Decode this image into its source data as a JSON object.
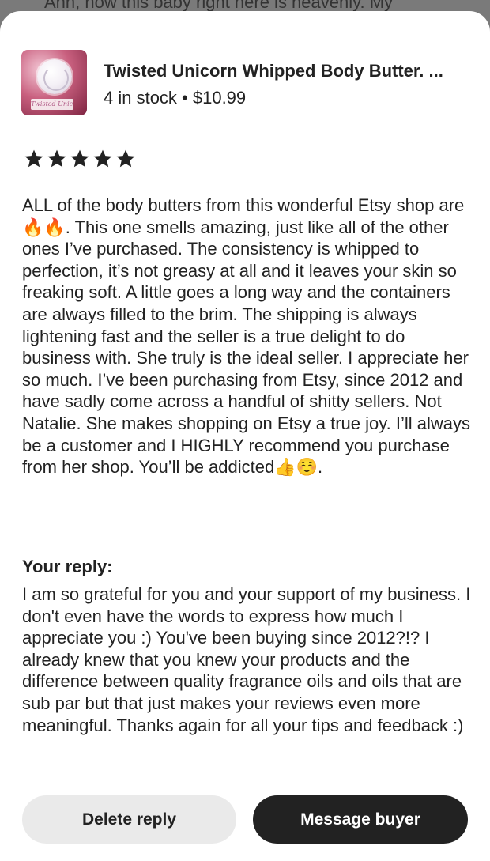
{
  "behind": {
    "text": "Ahh, now this baby right here is heavenly. My"
  },
  "product": {
    "title": "Twisted Unicorn Whipped Body Butter. ...",
    "meta": "4 in stock • $10.99",
    "thumbnail_logo_text": "Twisted Unicorn"
  },
  "review": {
    "rating": 5,
    "rating_max": 5,
    "text": "ALL of the body butters from this wonderful Etsy shop are 🔥🔥. This one smells amazing, just like all of the other ones I’ve purchased. The consistency is whipped to perfection, it’s not greasy at all and it leaves your skin so freaking soft. A little goes a long way and the containers are always filled to the brim. The shipping is always lightening fast and the seller is a true delight to do business with. She truly is the ideal seller. I appreciate her so much. I’ve been purchasing from Etsy, since 2012 and have sadly come across a handful of shitty sellers. Not Natalie. She makes shopping on Etsy a true joy. I’ll always be a customer and I HIGHLY recommend you purchase from her shop. You’ll be addicted👍☺️."
  },
  "reply": {
    "label": "Your reply:",
    "text": "I am so grateful for you and your support of my business. I don't even have the words to express how much I appreciate you :) You've been buying since 2012?!? I already knew that you knew your products and the difference between quality fragrance oils and oils that are sub par but that just makes your reviews even more meaningful. Thanks again for all your tips and feedback :)"
  },
  "actions": {
    "delete_label": "Delete reply",
    "message_label": "Message buyer"
  },
  "colors": {
    "primary_button": "#222222",
    "secondary_button": "#eaeaea",
    "star": "#222222"
  }
}
